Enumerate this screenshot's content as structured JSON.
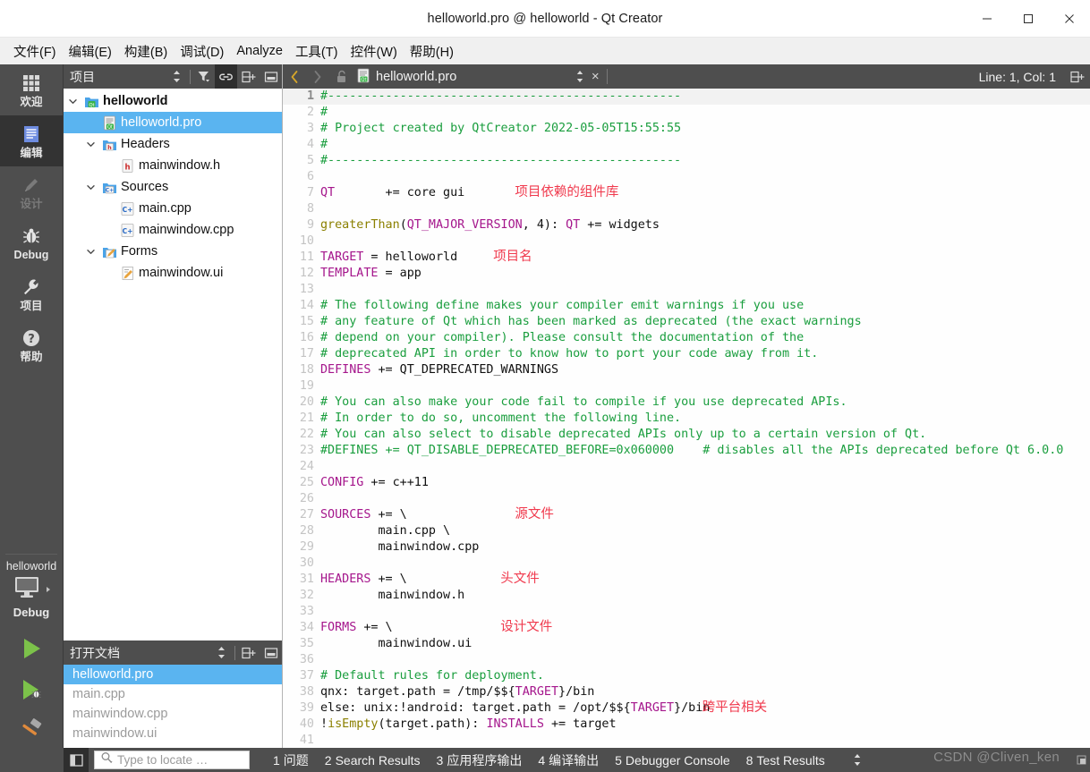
{
  "window": {
    "title": "helloworld.pro @ helloworld - Qt Creator",
    "minimize_label": "minimize",
    "maximize_label": "maximize",
    "close_label": "close"
  },
  "menubar": {
    "items": [
      {
        "label": "文件(F)"
      },
      {
        "label": "编辑(E)"
      },
      {
        "label": "构建(B)"
      },
      {
        "label": "调试(D)"
      },
      {
        "label": "Analyze"
      },
      {
        "label": "工具(T)"
      },
      {
        "label": "控件(W)"
      },
      {
        "label": "帮助(H)"
      }
    ]
  },
  "modebar": {
    "items": [
      {
        "label": "欢迎",
        "icon": "grid-icon",
        "state": "normal"
      },
      {
        "label": "编辑",
        "icon": "document-icon",
        "state": "active"
      },
      {
        "label": "设计",
        "icon": "pencil-icon",
        "state": "disabled"
      },
      {
        "label": "Debug",
        "icon": "bug-icon",
        "state": "normal"
      },
      {
        "label": "项目",
        "icon": "wrench-icon",
        "state": "normal"
      },
      {
        "label": "帮助",
        "icon": "question-icon",
        "state": "normal"
      }
    ],
    "kit": {
      "project_name": "helloworld",
      "build_config": "Debug",
      "target_icon": "desktop-icon",
      "run_label": "run-button",
      "debug_label": "debug-button",
      "build_label": "build-button"
    }
  },
  "project_panel": {
    "title": "项目",
    "toolbar": [
      {
        "name": "sort-arrows-icon"
      },
      {
        "name": "filter-icon"
      },
      {
        "name": "link-icon",
        "active": true
      },
      {
        "name": "split-icon"
      },
      {
        "name": "close-panel-icon"
      }
    ],
    "tree": [
      {
        "label": "helloworld",
        "indent": 0,
        "arrow": "down",
        "icon": "qt-project-icon",
        "bold": true,
        "selected": false
      },
      {
        "label": "helloworld.pro",
        "indent": 1,
        "arrow": "none",
        "icon": "pro-file-icon",
        "bold": false,
        "selected": true
      },
      {
        "label": "Headers",
        "indent": 1,
        "arrow": "down",
        "icon": "headers-folder-icon",
        "bold": false,
        "selected": false
      },
      {
        "label": "mainwindow.h",
        "indent": 2,
        "arrow": "none",
        "icon": "h-file-icon",
        "bold": false,
        "selected": false
      },
      {
        "label": "Sources",
        "indent": 1,
        "arrow": "down",
        "icon": "sources-folder-icon",
        "bold": false,
        "selected": false
      },
      {
        "label": "main.cpp",
        "indent": 2,
        "arrow": "none",
        "icon": "cpp-file-icon",
        "bold": false,
        "selected": false
      },
      {
        "label": "mainwindow.cpp",
        "indent": 2,
        "arrow": "none",
        "icon": "cpp-file-icon",
        "bold": false,
        "selected": false
      },
      {
        "label": "Forms",
        "indent": 1,
        "arrow": "down",
        "icon": "forms-folder-icon",
        "bold": false,
        "selected": false
      },
      {
        "label": "mainwindow.ui",
        "indent": 2,
        "arrow": "none",
        "icon": "ui-file-icon",
        "bold": false,
        "selected": false
      }
    ]
  },
  "open_documents": {
    "title": "打开文档",
    "toolbar": [
      {
        "name": "sort-arrows-icon"
      },
      {
        "name": "split-icon"
      },
      {
        "name": "close-panel-icon"
      }
    ],
    "items": [
      {
        "label": "helloworld.pro",
        "selected": true
      },
      {
        "label": "main.cpp",
        "selected": false
      },
      {
        "label": "mainwindow.cpp",
        "selected": false
      },
      {
        "label": "mainwindow.ui",
        "selected": false
      }
    ]
  },
  "editor_bar": {
    "back_label": "back",
    "forward_label": "forward",
    "lock_label": "unlocked",
    "file_icon": "pro-file-icon",
    "filename": "helloworld.pro",
    "close_label": "×",
    "line_col": "Line: 1, Col: 1",
    "split_label": "split-editor"
  },
  "editor": {
    "current_line": 1,
    "lines": [
      {
        "n": 1,
        "tokens": [
          {
            "t": "cm",
            "s": "#-------------------------------------------------"
          }
        ]
      },
      {
        "n": 2,
        "tokens": [
          {
            "t": "cm",
            "s": "#"
          }
        ]
      },
      {
        "n": 3,
        "tokens": [
          {
            "t": "cm",
            "s": "# Project created by QtCreator 2022-05-05T15:55:55"
          }
        ]
      },
      {
        "n": 4,
        "tokens": [
          {
            "t": "cm",
            "s": "#"
          }
        ]
      },
      {
        "n": 5,
        "tokens": [
          {
            "t": "cm",
            "s": "#-------------------------------------------------"
          }
        ]
      },
      {
        "n": 6,
        "tokens": []
      },
      {
        "n": 7,
        "tokens": [
          {
            "t": "kw",
            "s": "QT"
          },
          {
            "t": "pl",
            "s": "       += core gui"
          }
        ],
        "annotation": {
          "text": "项目依赖的组件库",
          "col": 27
        }
      },
      {
        "n": 8,
        "tokens": []
      },
      {
        "n": 9,
        "tokens": [
          {
            "t": "fn",
            "s": "greaterThan"
          },
          {
            "t": "pl",
            "s": "("
          },
          {
            "t": "kw",
            "s": "QT_MAJOR_VERSION"
          },
          {
            "t": "pl",
            "s": ", 4): "
          },
          {
            "t": "kw",
            "s": "QT"
          },
          {
            "t": "pl",
            "s": " += widgets"
          }
        ]
      },
      {
        "n": 10,
        "tokens": []
      },
      {
        "n": 11,
        "tokens": [
          {
            "t": "kw",
            "s": "TARGET"
          },
          {
            "t": "pl",
            "s": " = helloworld"
          }
        ],
        "annotation": {
          "text": "项目名",
          "col": 24
        }
      },
      {
        "n": 12,
        "tokens": [
          {
            "t": "kw",
            "s": "TEMPLATE"
          },
          {
            "t": "pl",
            "s": " = app"
          }
        ]
      },
      {
        "n": 13,
        "tokens": []
      },
      {
        "n": 14,
        "tokens": [
          {
            "t": "cm",
            "s": "# The following define makes your compiler emit warnings if you use"
          }
        ]
      },
      {
        "n": 15,
        "tokens": [
          {
            "t": "cm",
            "s": "# any feature of Qt which has been marked as deprecated (the exact warnings"
          }
        ]
      },
      {
        "n": 16,
        "tokens": [
          {
            "t": "cm",
            "s": "# depend on your compiler). Please consult the documentation of the"
          }
        ]
      },
      {
        "n": 17,
        "tokens": [
          {
            "t": "cm",
            "s": "# deprecated API in order to know how to port your code away from it."
          }
        ]
      },
      {
        "n": 18,
        "tokens": [
          {
            "t": "kw",
            "s": "DEFINES"
          },
          {
            "t": "pl",
            "s": " += QT_DEPRECATED_WARNINGS"
          }
        ]
      },
      {
        "n": 19,
        "tokens": []
      },
      {
        "n": 20,
        "tokens": [
          {
            "t": "cm",
            "s": "# You can also make your code fail to compile if you use deprecated APIs."
          }
        ]
      },
      {
        "n": 21,
        "tokens": [
          {
            "t": "cm",
            "s": "# In order to do so, uncomment the following line."
          }
        ]
      },
      {
        "n": 22,
        "tokens": [
          {
            "t": "cm",
            "s": "# You can also select to disable deprecated APIs only up to a certain version of Qt."
          }
        ]
      },
      {
        "n": 23,
        "tokens": [
          {
            "t": "cm",
            "s": "#DEFINES += QT_DISABLE_DEPRECATED_BEFORE=0x060000    # disables all the APIs deprecated before Qt 6.0.0"
          }
        ]
      },
      {
        "n": 24,
        "tokens": []
      },
      {
        "n": 25,
        "tokens": [
          {
            "t": "kw",
            "s": "CONFIG"
          },
          {
            "t": "pl",
            "s": " += c++11"
          }
        ]
      },
      {
        "n": 26,
        "tokens": []
      },
      {
        "n": 27,
        "tokens": [
          {
            "t": "kw",
            "s": "SOURCES"
          },
          {
            "t": "pl",
            "s": " += \\"
          }
        ],
        "annotation": {
          "text": "源文件",
          "col": 27
        }
      },
      {
        "n": 28,
        "tokens": [
          {
            "t": "pl",
            "s": "        main.cpp \\"
          }
        ]
      },
      {
        "n": 29,
        "tokens": [
          {
            "t": "pl",
            "s": "        mainwindow.cpp"
          }
        ]
      },
      {
        "n": 30,
        "tokens": []
      },
      {
        "n": 31,
        "tokens": [
          {
            "t": "kw",
            "s": "HEADERS"
          },
          {
            "t": "pl",
            "s": " += \\"
          }
        ],
        "annotation": {
          "text": "头文件",
          "col": 25
        }
      },
      {
        "n": 32,
        "tokens": [
          {
            "t": "pl",
            "s": "        mainwindow.h"
          }
        ]
      },
      {
        "n": 33,
        "tokens": []
      },
      {
        "n": 34,
        "tokens": [
          {
            "t": "kw",
            "s": "FORMS"
          },
          {
            "t": "pl",
            "s": " += \\"
          }
        ],
        "annotation": {
          "text": "设计文件",
          "col": 25
        }
      },
      {
        "n": 35,
        "tokens": [
          {
            "t": "pl",
            "s": "        mainwindow.ui"
          }
        ]
      },
      {
        "n": 36,
        "tokens": []
      },
      {
        "n": 37,
        "tokens": [
          {
            "t": "cm",
            "s": "# Default rules for deployment."
          }
        ]
      },
      {
        "n": 38,
        "tokens": [
          {
            "t": "pl",
            "s": "qnx: target.path = /tmp/$${"
          },
          {
            "t": "kw",
            "s": "TARGET"
          },
          {
            "t": "pl",
            "s": "}/bin"
          }
        ]
      },
      {
        "n": 39,
        "tokens": [
          {
            "t": "pl",
            "s": "else: unix:!android: target.path = /opt/$${"
          },
          {
            "t": "kw",
            "s": "TARGET"
          },
          {
            "t": "pl",
            "s": "}/bin"
          }
        ],
        "annotation": {
          "text": "跨平台相关",
          "col": 53
        }
      },
      {
        "n": 40,
        "tokens": [
          {
            "t": "pl",
            "s": "!"
          },
          {
            "t": "fn",
            "s": "isEmpty"
          },
          {
            "t": "pl",
            "s": "(target.path): "
          },
          {
            "t": "kw",
            "s": "INSTALLS"
          },
          {
            "t": "pl",
            "s": " += target"
          }
        ]
      },
      {
        "n": 41,
        "tokens": []
      }
    ]
  },
  "statusbar": {
    "toggle_sidebar_label": "toggle-output-pane",
    "locator_placeholder": "Type to locate …",
    "locator_value": "",
    "tabs": [
      {
        "num": "1",
        "label": "问题"
      },
      {
        "num": "2",
        "label": "Search Results"
      },
      {
        "num": "3",
        "label": "应用程序输出"
      },
      {
        "num": "4",
        "label": "编译输出"
      },
      {
        "num": "5",
        "label": "Debugger Console"
      },
      {
        "num": "8",
        "label": "Test Results"
      }
    ],
    "watermark": "CSDN @Cliven_ken"
  },
  "colors": {
    "chrome_dark": "#4e4e4e",
    "selection_blue": "#5ab4f0",
    "comment_green": "#1a9e3e",
    "variable_magenta": "#a5168c",
    "function_olive": "#8b8000",
    "annotation_red": "#f0394d"
  }
}
